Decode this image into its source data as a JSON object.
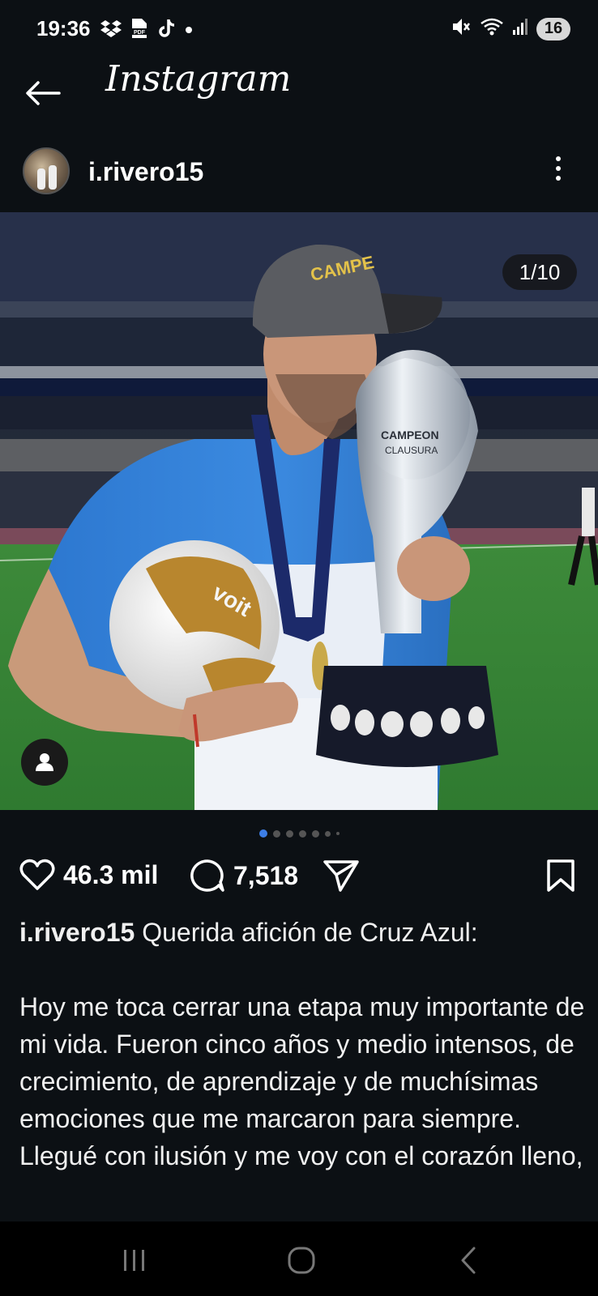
{
  "status_bar": {
    "time": "19:36",
    "battery": "16",
    "left_icons": [
      "dropbox-icon",
      "pdf-icon",
      "tiktok-icon",
      "dot-icon"
    ],
    "right_icons": [
      "mute-icon",
      "wifi-icon",
      "signal-icon"
    ]
  },
  "header": {
    "title": "Instagram",
    "back_icon": "arrow-left-icon"
  },
  "post": {
    "username": "i.rivero15",
    "image_counter": "1/10",
    "carousel": {
      "total_visible_dots": 7,
      "active_index": 0
    },
    "likes": "46.3 mil",
    "comments": "7,518",
    "caption_username": "i.rivero15",
    "caption_first_line": "Querida afición de Cruz Azul:",
    "caption_body": "Hoy me toca cerrar una etapa muy importante de mi vida. Fueron cinco años y medio intensos, de crecimiento, de aprendizaje y de muchísimas emociones que me marcaron para siempre. Llegué con ilusión y me voy con el corazón lleno,"
  },
  "colors": {
    "background": "#0c1014",
    "active_dot": "#3d7ee6",
    "nav_bar": "#000000"
  },
  "nav": {
    "icons": [
      "recent-apps-icon",
      "home-icon",
      "back-icon"
    ]
  }
}
